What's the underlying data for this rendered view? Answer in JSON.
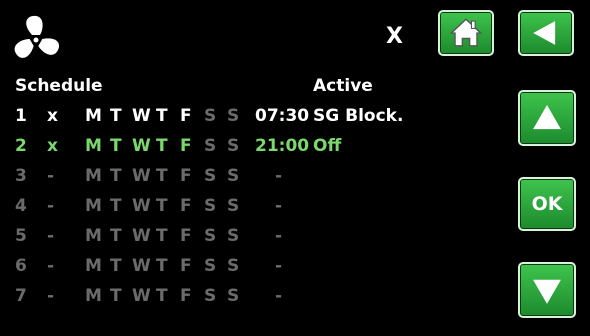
{
  "header": {
    "close_label": "X"
  },
  "table": {
    "col_schedule": "Schedule",
    "col_active": "Active"
  },
  "colors": {
    "white": "#ffffff",
    "green": "#7bd86c",
    "gray": "#6b6b6b",
    "button": "#2fb041"
  },
  "rows": [
    {
      "num": "1",
      "mark": "x",
      "days": [
        "M",
        "T",
        "W",
        "T",
        "F",
        "S",
        "S"
      ],
      "day_on": [
        1,
        1,
        1,
        1,
        1,
        0,
        0
      ],
      "time": "07:30",
      "action": "SG Block.",
      "state": "white"
    },
    {
      "num": "2",
      "mark": "x",
      "days": [
        "M",
        "T",
        "W",
        "T",
        "F",
        "S",
        "S"
      ],
      "day_on": [
        1,
        1,
        1,
        1,
        1,
        0,
        0
      ],
      "time": "21:00",
      "action": "Off",
      "state": "green"
    },
    {
      "num": "3",
      "mark": "-",
      "days": [
        "M",
        "T",
        "W",
        "T",
        "F",
        "S",
        "S"
      ],
      "day_on": [
        0,
        0,
        0,
        0,
        0,
        0,
        0
      ],
      "time": "-",
      "action": "",
      "state": "gray"
    },
    {
      "num": "4",
      "mark": "-",
      "days": [
        "M",
        "T",
        "W",
        "T",
        "F",
        "S",
        "S"
      ],
      "day_on": [
        0,
        0,
        0,
        0,
        0,
        0,
        0
      ],
      "time": "-",
      "action": "",
      "state": "gray"
    },
    {
      "num": "5",
      "mark": "-",
      "days": [
        "M",
        "T",
        "W",
        "T",
        "F",
        "S",
        "S"
      ],
      "day_on": [
        0,
        0,
        0,
        0,
        0,
        0,
        0
      ],
      "time": "-",
      "action": "",
      "state": "gray"
    },
    {
      "num": "6",
      "mark": "-",
      "days": [
        "M",
        "T",
        "W",
        "T",
        "F",
        "S",
        "S"
      ],
      "day_on": [
        0,
        0,
        0,
        0,
        0,
        0,
        0
      ],
      "time": "-",
      "action": "",
      "state": "gray"
    },
    {
      "num": "7",
      "mark": "-",
      "days": [
        "M",
        "T",
        "W",
        "T",
        "F",
        "S",
        "S"
      ],
      "day_on": [
        0,
        0,
        0,
        0,
        0,
        0,
        0
      ],
      "time": "-",
      "action": "",
      "state": "gray"
    }
  ],
  "buttons": {
    "ok_label": "OK"
  },
  "icons": {
    "fan": "fan-icon",
    "home": "home-icon",
    "back": "back-arrow-icon",
    "up": "arrow-up-icon",
    "down": "arrow-down-icon"
  }
}
